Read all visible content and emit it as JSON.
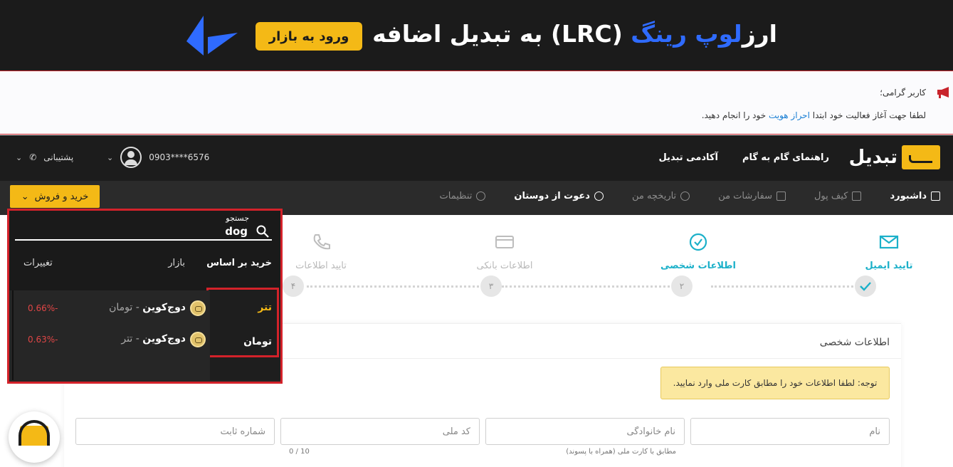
{
  "banner": {
    "text_prefix": "ارز",
    "text_highlight": "لوپ رینگ",
    "text_symbol": "(LRC)",
    "text_suffix": "به تبدیل اضافه شد.",
    "button": "ورود به بازار"
  },
  "notice": {
    "title": "کاربر گرامی؛",
    "body_before": "لطفا جهت آغاز فعالیت خود ابتدا",
    "link": "احراز هویت",
    "body_after": "خود را انجام دهید."
  },
  "header": {
    "brand": "تبدیل",
    "nav": [
      "راهنمای گام به گام",
      "آکادمی تبدیل"
    ],
    "phone": "0903****6576",
    "support": "پشتیبانی"
  },
  "subnav": {
    "items": [
      "داشبورد",
      "کیف پول",
      "سفارشات من",
      "تاریخچه من",
      "دعوت از دوستان",
      "تنظیمات"
    ],
    "trade_button": "خرید و فروش"
  },
  "steps": {
    "items": [
      "تایید ایمیل",
      "اطلاعات شخصی",
      "اطلاعات بانکی",
      "تایید اطلاعات"
    ],
    "numbers": [
      "۲",
      "۳",
      "۴"
    ]
  },
  "form": {
    "title": "اطلاعات شخصی",
    "warning": "توجه: لطفا اطلاعات خود را مطابق کارت ملی وارد نمایید.",
    "fields": {
      "first_name": "نام",
      "last_name": "نام خانوادگی",
      "national_code": "کد ملی",
      "phone": "شماره ثابت"
    },
    "hint_name": "مطابق با کارت ملی (همراه با پسوند)",
    "hint_count": "0 / 10"
  },
  "dropdown": {
    "search_label": "جستجو",
    "search_value": "dog",
    "columns": {
      "by": "خرید بر اساس",
      "market": "بازار",
      "change": "تغییرات"
    },
    "tabs": [
      "تتر",
      "تومان"
    ],
    "rows": [
      {
        "coin": "دوج‌کوین",
        "separator": " - ",
        "quote": "تومان",
        "change": "-0.66%"
      },
      {
        "coin": "دوج‌کوین",
        "separator": " - ",
        "quote": "تتر",
        "change": "-0.63%"
      }
    ]
  },
  "colors": {
    "brand": "#f4b916",
    "accent": "#1bb0c9",
    "danger": "#d3222a",
    "negative": "#e04646"
  }
}
